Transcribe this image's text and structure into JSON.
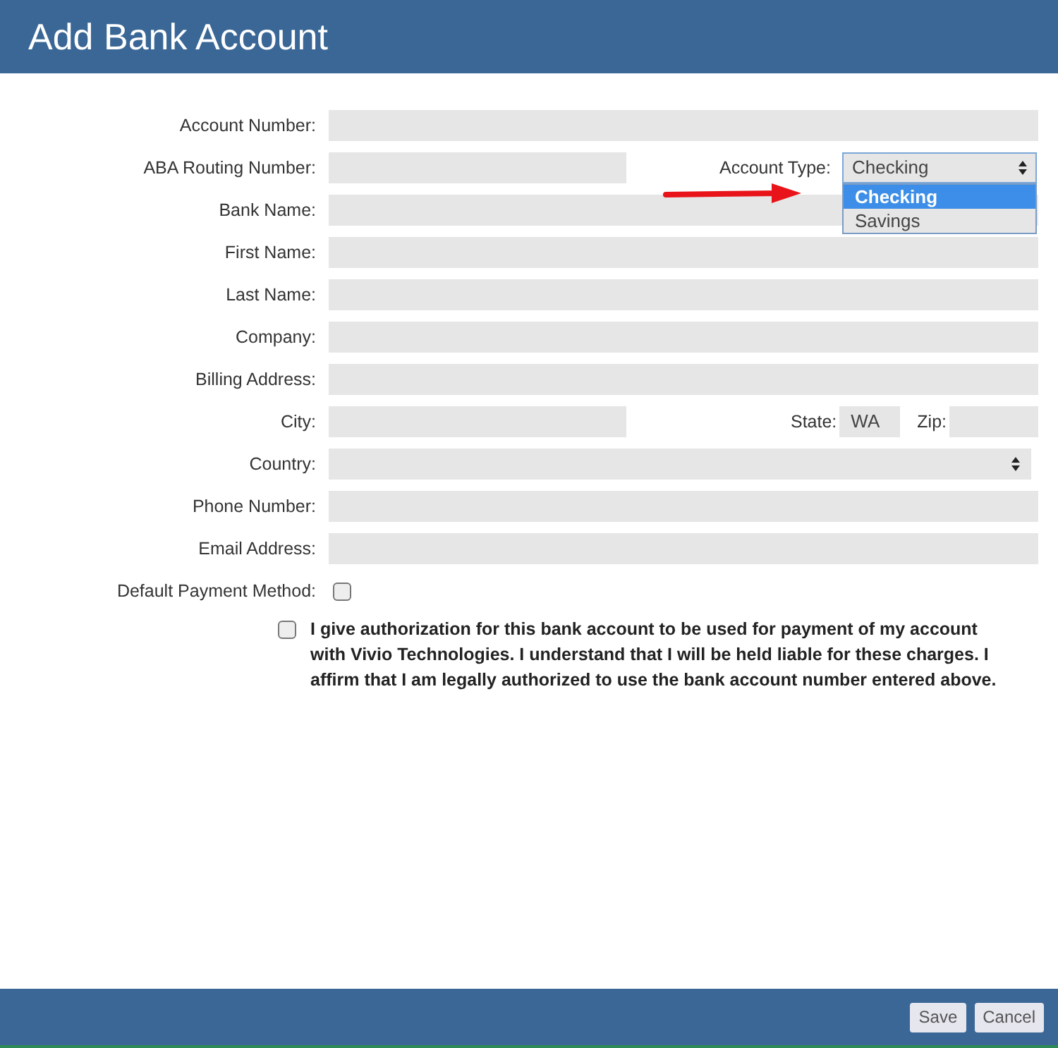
{
  "title": "Add Bank Account",
  "rows": [
    {
      "kind": "text",
      "label": "Account Number:"
    },
    {
      "kind": "routing",
      "label": "ABA Routing Number:",
      "account_type": {
        "label": "Account Type:",
        "value": "Checking",
        "options": [
          {
            "label": "Checking",
            "selected": true
          },
          {
            "label": "Savings",
            "selected": false
          }
        ]
      }
    },
    {
      "kind": "text",
      "label": "Bank Name:"
    },
    {
      "kind": "text",
      "label": "First Name:"
    },
    {
      "kind": "text",
      "label": "Last Name:"
    },
    {
      "kind": "text",
      "label": "Company:"
    },
    {
      "kind": "text",
      "label": "Billing Address:"
    },
    {
      "kind": "city",
      "label": "City:",
      "state": {
        "label": "State:",
        "value": "WA"
      },
      "zip": {
        "label": "Zip:"
      }
    },
    {
      "kind": "select",
      "label": "Country:"
    },
    {
      "kind": "text",
      "label": "Phone Number:"
    },
    {
      "kind": "text",
      "label": "Email Address:"
    },
    {
      "kind": "checkbox",
      "label": "Default Payment Method:",
      "checked": false
    }
  ],
  "authorization": {
    "checked": false,
    "text": "I give authorization for this bank account to be used for payment of my account with Vivio Technologies. I understand that I will be held liable for these charges. I affirm that I am legally authorized to use the bank account number entered above."
  },
  "buttons": [
    "Save",
    "Cancel"
  ]
}
